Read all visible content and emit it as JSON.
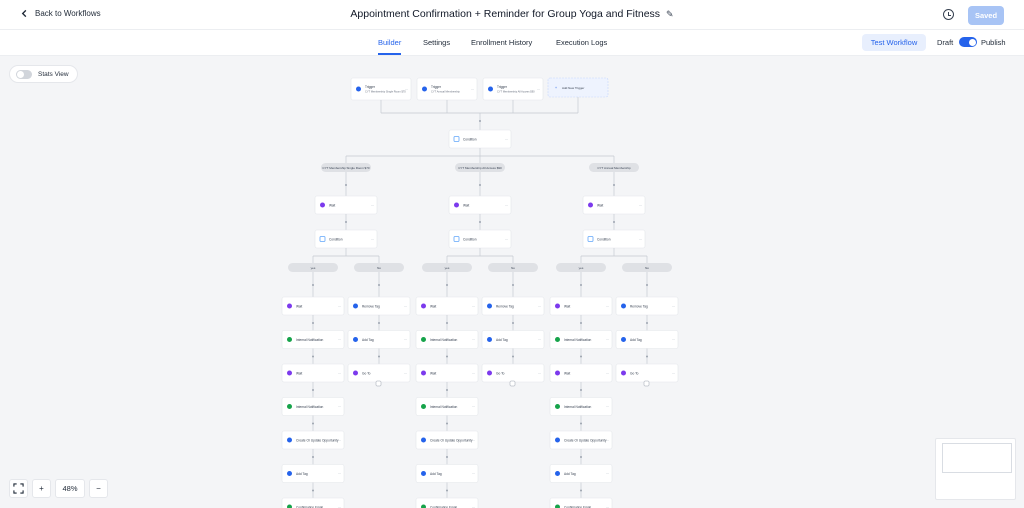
{
  "header": {
    "back_label": "Back to Workflows",
    "title": "Appointment Confirmation + Reminder for Group Yoga and Fitness",
    "saved_label": "Saved"
  },
  "tabs": [
    {
      "label": "Builder",
      "active": true
    },
    {
      "label": "Settings",
      "active": false
    },
    {
      "label": "Enrollment History",
      "active": false
    },
    {
      "label": "Execution Logs",
      "active": false
    }
  ],
  "actions": {
    "test_label": "Test Workflow",
    "draft_label": "Draft",
    "publish_label": "Publish",
    "published": true
  },
  "stats_view": {
    "label": "Stats View",
    "on": false
  },
  "zoom": {
    "level": "48%",
    "plus": "+",
    "minus": "−"
  },
  "colors": {
    "accent": "#2563eb",
    "wait": "#7c3aed",
    "notif": "#16a34a",
    "tag": "#2563eb",
    "goto": "#7c3aed"
  },
  "workflow": {
    "triggers": [
      {
        "label": "Trigger",
        "sub": "CYT Membership Single Room $70"
      },
      {
        "label": "Trigger",
        "sub": "CYT Annual Membership"
      },
      {
        "label": "Trigger",
        "sub": "CYT Membership All Access $90"
      }
    ],
    "add_trigger": "Add New Trigger",
    "top_condition": "Condition",
    "branches": [
      {
        "name": "CYT Membership Single Room $70",
        "wait": "Wait",
        "condition": "Condition",
        "yes_label": "yes",
        "no_label": "No",
        "yes_steps": [
          {
            "label": "Wait",
            "kind": "wait"
          },
          {
            "label": "Internal Notification",
            "kind": "notif"
          },
          {
            "label": "Wait",
            "kind": "wait"
          },
          {
            "label": "Internal Notification",
            "kind": "notif"
          },
          {
            "label": "Create Or Update Opportunity",
            "kind": "opp"
          },
          {
            "label": "Add Tag",
            "kind": "tag"
          },
          {
            "label": "Confirmation Email",
            "kind": "notif"
          }
        ],
        "no_steps": [
          {
            "label": "Remove Tag",
            "kind": "tag"
          },
          {
            "label": "Add Tag",
            "kind": "tag"
          },
          {
            "label": "Go To",
            "kind": "goto"
          }
        ]
      },
      {
        "name": "CYT Membership All Access $90",
        "wait": "Wait",
        "condition": "Condition",
        "yes_label": "yes",
        "no_label": "No",
        "yes_steps": [
          {
            "label": "Wait",
            "kind": "wait"
          },
          {
            "label": "Internal Notification",
            "kind": "notif"
          },
          {
            "label": "Wait",
            "kind": "wait"
          },
          {
            "label": "Internal Notification",
            "kind": "notif"
          },
          {
            "label": "Create Or Update Opportunity",
            "kind": "opp"
          },
          {
            "label": "Add Tag",
            "kind": "tag"
          },
          {
            "label": "Confirmation Email",
            "kind": "notif"
          }
        ],
        "no_steps": [
          {
            "label": "Remove Tag",
            "kind": "tag"
          },
          {
            "label": "Add Tag",
            "kind": "tag"
          },
          {
            "label": "Go To",
            "kind": "goto"
          }
        ]
      },
      {
        "name": "CYT Annual Membership",
        "wait": "Wait",
        "condition": "Condition",
        "yes_label": "yes",
        "no_label": "No",
        "yes_steps": [
          {
            "label": "Wait",
            "kind": "wait"
          },
          {
            "label": "Internal Notification",
            "kind": "notif"
          },
          {
            "label": "Wait",
            "kind": "wait"
          },
          {
            "label": "Internal Notification",
            "kind": "notif"
          },
          {
            "label": "Create Or Update Opportunity",
            "kind": "opp"
          },
          {
            "label": "Add Tag",
            "kind": "tag"
          },
          {
            "label": "Confirmation Email",
            "kind": "notif"
          }
        ],
        "no_steps": [
          {
            "label": "Remove Tag",
            "kind": "tag"
          },
          {
            "label": "Add Tag",
            "kind": "tag"
          },
          {
            "label": "Go To",
            "kind": "goto"
          }
        ]
      }
    ]
  }
}
